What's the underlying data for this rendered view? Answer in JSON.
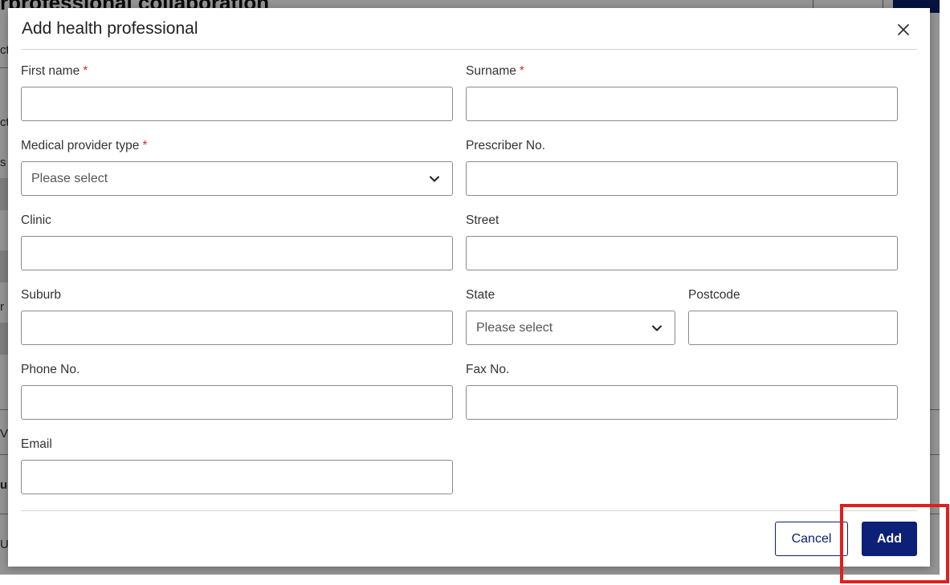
{
  "background": {
    "page_title_fragment": "rprofessional collaboration",
    "fragments": [
      "ct",
      "ct",
      "s",
      "r",
      "V",
      "u",
      "UN"
    ]
  },
  "modal": {
    "title": "Add health professional",
    "close_icon": "close-icon",
    "fields": {
      "first_name": {
        "label": "First name",
        "required": "*",
        "value": ""
      },
      "surname": {
        "label": "Surname",
        "required": "*",
        "value": ""
      },
      "medical_provider_type": {
        "label": "Medical provider type",
        "required": "*",
        "selected": "Please select"
      },
      "prescriber_no": {
        "label": "Prescriber No.",
        "value": ""
      },
      "clinic": {
        "label": "Clinic",
        "value": ""
      },
      "street": {
        "label": "Street",
        "value": ""
      },
      "suburb": {
        "label": "Suburb",
        "value": ""
      },
      "state": {
        "label": "State",
        "selected": "Please select"
      },
      "postcode": {
        "label": "Postcode",
        "value": ""
      },
      "phone_no": {
        "label": "Phone No.",
        "value": ""
      },
      "fax_no": {
        "label": "Fax No.",
        "value": ""
      },
      "email": {
        "label": "Email",
        "value": ""
      }
    },
    "buttons": {
      "cancel": "Cancel",
      "add": "Add"
    }
  },
  "colors": {
    "primary": "#0b2076",
    "required": "#d32f2f",
    "highlight": "#e01f1f"
  }
}
